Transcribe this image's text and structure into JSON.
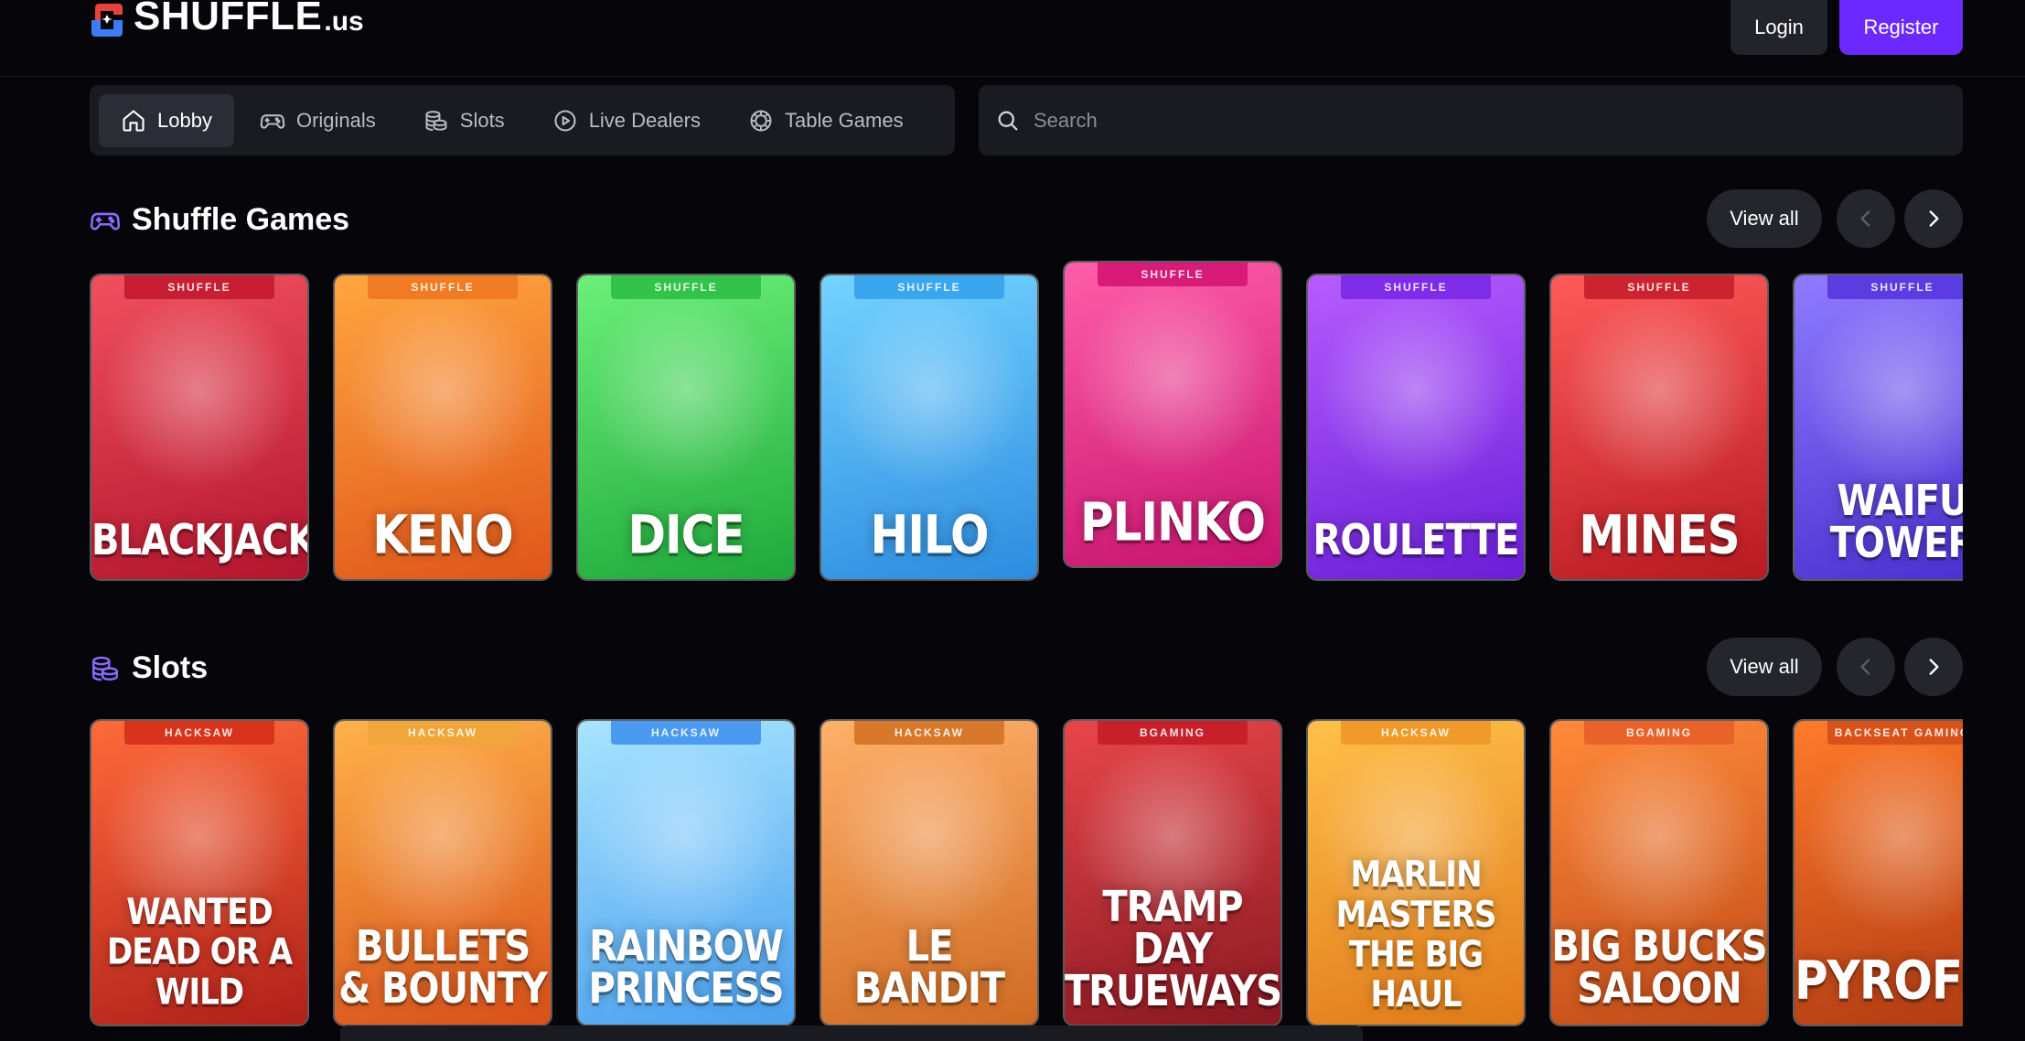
{
  "brand": {
    "name": "SHUFFLE",
    "suffix": ".us",
    "accent": "#6b29ff",
    "logo_red": "#e8423f",
    "logo_blue": "#3d7bf7"
  },
  "header": {
    "login_label": "Login",
    "register_label": "Register"
  },
  "nav": {
    "items": [
      {
        "label": "Lobby",
        "icon": "home-icon",
        "active": true
      },
      {
        "label": "Originals",
        "icon": "gamepad-icon",
        "active": false
      },
      {
        "label": "Slots",
        "icon": "coins-icon",
        "active": false
      },
      {
        "label": "Live Dealers",
        "icon": "play-circle-icon",
        "active": false
      },
      {
        "label": "Table Games",
        "icon": "chip-icon",
        "active": false
      }
    ]
  },
  "search": {
    "placeholder": "Search",
    "value": ""
  },
  "sections": [
    {
      "title": "Shuffle Games",
      "icon": "gamepad-icon",
      "view_all_label": "View all",
      "games": [
        {
          "name": "BLACKJACK",
          "provider": "SHUFFLE",
          "colors": [
            "#f0505e",
            "#b3152e"
          ],
          "tag_color": "#c81e34"
        },
        {
          "name": "KENO",
          "provider": "SHUFFLE",
          "colors": [
            "#ffa640",
            "#e0561a"
          ],
          "tag_color": "#f07b22"
        },
        {
          "name": "DICE",
          "provider": "SHUFFLE",
          "colors": [
            "#6cf07a",
            "#1fa83a"
          ],
          "tag_color": "#33c24a"
        },
        {
          "name": "HILO",
          "provider": "SHUFFLE",
          "colors": [
            "#74d3ff",
            "#2c8ce0"
          ],
          "tag_color": "#3aa6ee"
        },
        {
          "name": "PLINKO",
          "provider": "SHUFFLE",
          "colors": [
            "#ff5ea8",
            "#c8136e"
          ],
          "tag_color": "#d81a78"
        },
        {
          "name": "ROULETTE",
          "provider": "SHUFFLE",
          "colors": [
            "#b65cff",
            "#6a1fd8"
          ],
          "tag_color": "#7f2ce8"
        },
        {
          "name": "MINES",
          "provider": "SHUFFLE",
          "colors": [
            "#ff5a5a",
            "#b81a22"
          ],
          "tag_color": "#cc2330"
        },
        {
          "name": "WAIFU TOWER",
          "provider": "SHUFFLE",
          "colors": [
            "#8f7bff",
            "#4a2fd0"
          ],
          "tag_color": "#5b3ce0"
        }
      ]
    },
    {
      "title": "Slots",
      "icon": "coins-icon",
      "view_all_label": "View all",
      "games": [
        {
          "name": "WANTED\nDEAD OR A WILD",
          "provider": "HACKSAW",
          "colors": [
            "#ff6a3a",
            "#b0201a"
          ],
          "tag_color": "#d8331c"
        },
        {
          "name": "BULLETS\n& BOUNTY",
          "provider": "HACKSAW",
          "colors": [
            "#ffb24a",
            "#d8501a"
          ],
          "tag_color": "#f0a63a"
        },
        {
          "name": "RAINBOW\nPRINCESS",
          "provider": "HACKSAW",
          "colors": [
            "#a8e4ff",
            "#4aa0f0"
          ],
          "tag_color": "#4a9af0"
        },
        {
          "name": "LE\nBANDIT",
          "provider": "HACKSAW",
          "colors": [
            "#ffb06a",
            "#d06a22"
          ],
          "tag_color": "#d8782a"
        },
        {
          "name": "TRAMP DAY\nTRUEWAYS",
          "provider": "BGAMING",
          "colors": [
            "#e8464a",
            "#8a1822"
          ],
          "tag_color": "#c8202a"
        },
        {
          "name": "MARLIN MASTERS\nTHE BIG HAUL",
          "provider": "HACKSAW",
          "colors": [
            "#ffc04a",
            "#e07a1a"
          ],
          "tag_color": "#f09a2a"
        },
        {
          "name": "BIG BUCKS\nSALOON",
          "provider": "BGAMING",
          "colors": [
            "#ff8a3a",
            "#c04a18"
          ],
          "tag_color": "#e8622a"
        },
        {
          "name": "PYROFOX",
          "provider": "BACKSEAT GAMING",
          "colors": [
            "#ff7a2a",
            "#b03a12"
          ],
          "tag_color": "#d8521a"
        }
      ]
    }
  ]
}
